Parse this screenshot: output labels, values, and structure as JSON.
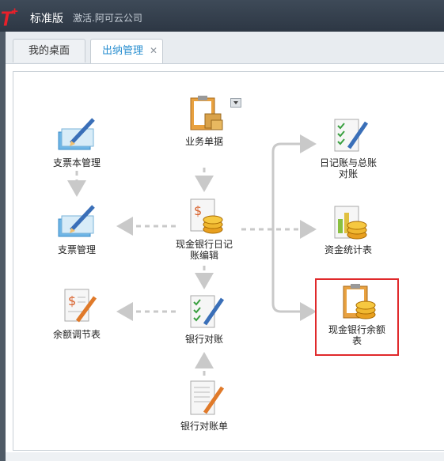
{
  "app": {
    "logo": "T+",
    "edition": "标准版",
    "company": "激活.阿可云公司"
  },
  "tabs": [
    {
      "label": "我的桌面"
    },
    {
      "label": "出纳管理",
      "active": true,
      "close_icon": "close-icon"
    }
  ],
  "nodes": {
    "cheque_book": "支票本管理",
    "cheque": "支票管理",
    "balance_adjust": "余额调节表",
    "business_doc": "业务单据",
    "cash_bank_journal": "现金银行日记账编辑",
    "bank_reconcile": "银行对账",
    "bank_statement": "银行对账单",
    "journal_gl_reconcile": "日记账与总账对账",
    "fund_stats": "资金统计表",
    "cash_bank_balance": "现金银行余额表"
  },
  "colors": {
    "selection_border": "#e0292b",
    "active_tab_text": "#2a8fd0",
    "arrow": "#c9c9c9"
  }
}
